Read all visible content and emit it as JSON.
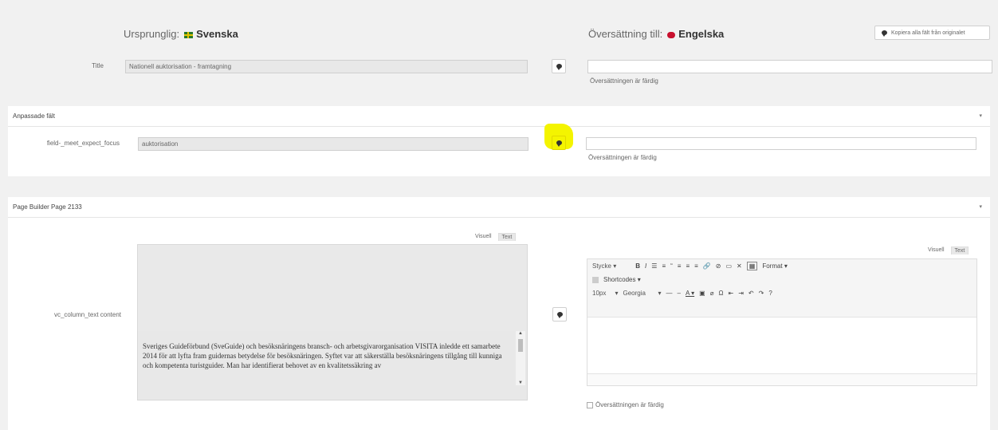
{
  "header": {
    "orig_prefix": "Ursprunglig:",
    "orig_lang": "Svenska",
    "trans_prefix": "Översättning till:",
    "trans_lang": "Engelska",
    "copy_all_label": "Kopiera alla fält från originalet"
  },
  "title_field": {
    "label": "Title",
    "original_value": "Nationell auktorisation - framtagning",
    "translation_value": "",
    "done_label": "Översättningen är färdig"
  },
  "custom_fields": {
    "section_title": "Anpassade fält",
    "field_label": "field-_meet_expect_focus",
    "original_value": "auktorisation",
    "translation_value": "",
    "done_label": "Översättningen är färdig"
  },
  "page_builder": {
    "section_title": "Page Builder Page 2133",
    "field_label": "vc_column_text content",
    "tabs": {
      "visual": "Visuell",
      "text": "Text"
    },
    "original_text": "Sveriges Guideförbund (SveGuide) och besöksnäringens bransch- och arbetsgivarorganisation VISITA inledde ett samarbete 2014 för att lyfta fram guidernas betydelse för besöksnäringen. Syftet var att säkerställa besöksnäringens tillgång till kunniga och kompetenta turistguider. Man har identifierat behovet av en kvalitetssäkring av",
    "toolbar": {
      "paragraph": "Stycke",
      "format": "Format",
      "shortcodes": "Shortcodes",
      "size": "10px",
      "font": "Georgia"
    },
    "done_label": "Översättningen är färdig"
  }
}
